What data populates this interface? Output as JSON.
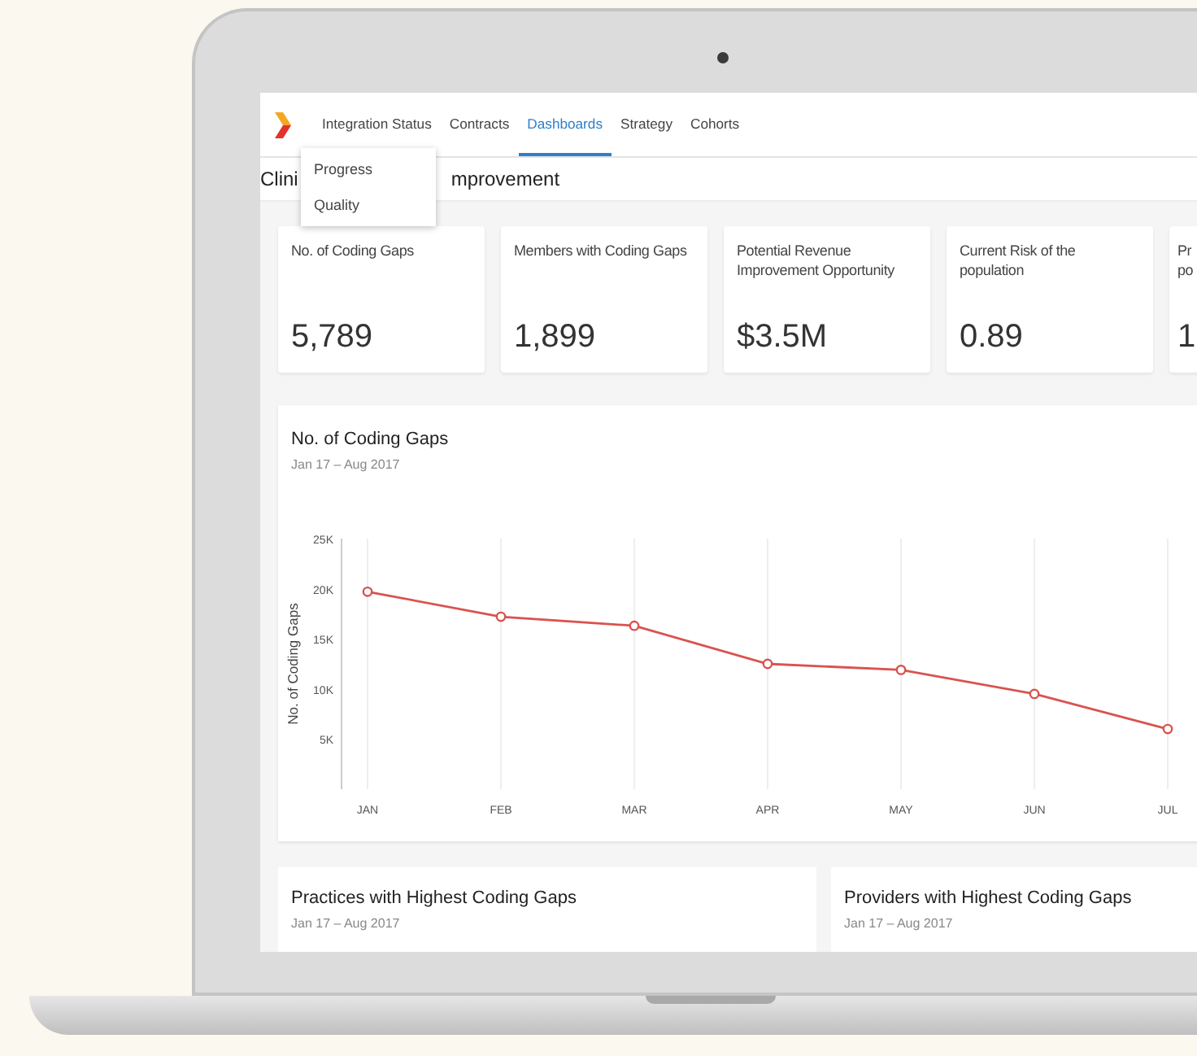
{
  "nav": {
    "items": [
      {
        "label": "Integration Status",
        "selected": false
      },
      {
        "label": "Contracts",
        "selected": false
      },
      {
        "label": "Dashboards",
        "selected": true
      },
      {
        "label": "Strategy",
        "selected": false
      },
      {
        "label": "Cohorts",
        "selected": false
      }
    ]
  },
  "dropdown": {
    "items": [
      "Progress",
      "Quality"
    ]
  },
  "page_title": {
    "visible_start": "Clini",
    "visible_end": "mprovement"
  },
  "stat_cards": [
    {
      "label": "No. of Coding Gaps",
      "value": "5,789"
    },
    {
      "label": "Members with Coding Gaps",
      "value": "1,899"
    },
    {
      "label": "Potential Revenue Improvement Opportunity",
      "value": "$3.5M"
    },
    {
      "label": "Current Risk of the population",
      "value": "0.89"
    },
    {
      "label": "Pr po",
      "value": "1"
    }
  ],
  "chart_card": {
    "title": "No. of Coding Gaps",
    "subtitle": "Jan 17 – Aug 2017",
    "chart_data": {
      "type": "line",
      "ylabel": "No. of Coding Gaps",
      "categories": [
        "JAN",
        "FEB",
        "MAR",
        "APR",
        "MAY",
        "JUN",
        "JUL"
      ],
      "grid": true,
      "series": [
        {
          "color": "#d9534f",
          "marker": "circle",
          "values": [
            19700,
            17200,
            16300,
            12500,
            11900,
            9500,
            6000
          ]
        }
      ],
      "ylim": [
        0,
        25000
      ],
      "yticks": [
        {
          "value": 5000,
          "label": "5K"
        },
        {
          "value": 10000,
          "label": "10K"
        },
        {
          "value": 15000,
          "label": "15K"
        },
        {
          "value": 20000,
          "label": "20K"
        },
        {
          "value": 25000,
          "label": "25K"
        }
      ]
    }
  },
  "bottom_cards": [
    {
      "title": "Practices with Highest Coding Gaps",
      "subtitle": "Jan 17 – Aug 2017"
    },
    {
      "title": "Providers with Highest Coding Gaps",
      "subtitle": "Jan 17 – Aug 2017"
    }
  ]
}
